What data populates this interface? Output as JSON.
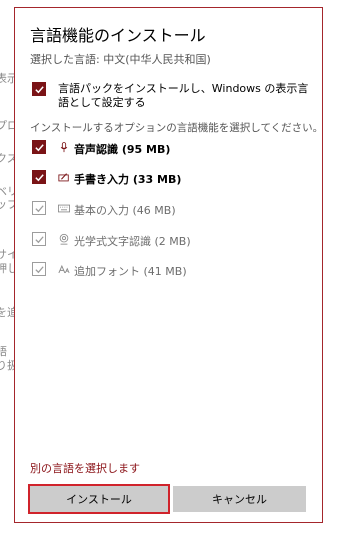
{
  "background": {
    "fragments": [
      "表示",
      "プロー",
      "クス",
      "ベリ",
      "ップ",
      "サイ",
      "押し",
      "を追",
      "語",
      "り扱"
    ]
  },
  "dialog": {
    "title": "言語機能のインストール",
    "subtitle": "選択した言語: 中文(中华人民共和国)",
    "language_pack": {
      "checked": true,
      "label": "言語パックをインストールし、Windows の表示言語として設定する"
    },
    "section_label": "インストールするオプションの言語機能を選択してください。",
    "features": [
      {
        "icon": "microphone-icon",
        "label": "音声認識 (95 MB)",
        "checked": true
      },
      {
        "icon": "handwriting-icon",
        "label": "手書き入力 (33 MB)",
        "checked": true
      },
      {
        "icon": "keyboard-icon",
        "label": "基本の入力 (46 MB)",
        "checked": true,
        "disabled": true
      },
      {
        "icon": "ocr-eye-icon",
        "label": "光学式文字認識 (2 MB)",
        "checked": true,
        "disabled": true
      },
      {
        "icon": "font-icon",
        "label": "追加フォント (41 MB)",
        "checked": true,
        "disabled": true
      }
    ],
    "choose_other_link": "別の言語を選択します",
    "install_label": "インストール",
    "cancel_label": "キャンセル",
    "accent_color": "#7a1316",
    "focus_color": "#d0232b"
  }
}
